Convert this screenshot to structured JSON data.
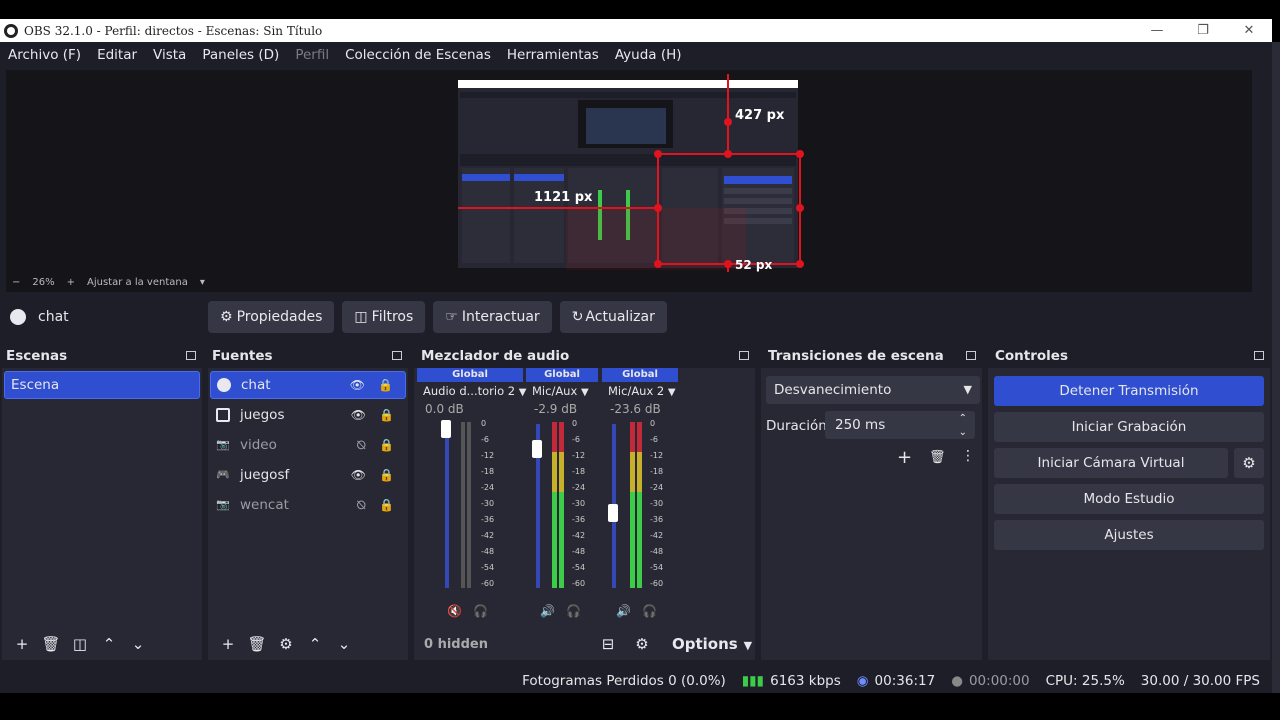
{
  "window": {
    "title": "OBS 32.1.0 - Perfil: directos - Escenas: Sin Título"
  },
  "menu": [
    "Archivo (F)",
    "Editar",
    "Vista",
    "Paneles (D)",
    "Perfil",
    "Colección de Escenas",
    "Herramientas",
    "Ayuda (H)"
  ],
  "preview": {
    "zoom_minus": "−",
    "zoom_value": "26%",
    "zoom_plus": "+",
    "zoom_mode": "Ajustar a la ventana",
    "measure_top": "427 px",
    "measure_left": "1121 px",
    "measure_bottom": "52 px"
  },
  "sourcebar": {
    "selected_source": "chat",
    "properties": "Propiedades",
    "filters": "Filtros",
    "interact": "Interactuar",
    "refresh": "Actualizar"
  },
  "scenes": {
    "title": "Escenas",
    "items": [
      "Escena"
    ]
  },
  "sources": {
    "title": "Fuentes",
    "items": [
      {
        "name": "chat",
        "icon": "globe-icon",
        "visible": true
      },
      {
        "name": "juegos",
        "icon": "monitor-icon",
        "visible": true
      },
      {
        "name": "video",
        "icon": "camera-icon",
        "visible": false
      },
      {
        "name": "juegosf",
        "icon": "gamepad-icon",
        "visible": true
      },
      {
        "name": "wencat",
        "icon": "camera-icon",
        "visible": false
      }
    ]
  },
  "mixer": {
    "title": "Mezclador de audio",
    "hidden": "0 hidden",
    "options": "Options",
    "channels": [
      {
        "head": "Global",
        "name": "Audio d...torio 2",
        "db": "0.0 dB",
        "level": 1.0
      },
      {
        "head": "Global",
        "name": "Mic/Aux",
        "db": "-2.9 dB",
        "level": 0.82
      },
      {
        "head": "Global",
        "name": "Mic/Aux 2",
        "db": "-23.6 dB",
        "level": 0.45
      }
    ],
    "scale": [
      "0",
      "-6",
      "-12",
      "-18",
      "-24",
      "-30",
      "-36",
      "-42",
      "-48",
      "-54",
      "-60"
    ]
  },
  "transitions": {
    "title": "Transiciones de escena",
    "selected": "Desvanecimiento",
    "duration_label": "Duración",
    "duration_value": "250 ms"
  },
  "controls": {
    "title": "Controles",
    "stop_stream": "Detener Transmisión",
    "start_record": "Iniciar Grabación",
    "virtual_cam": "Iniciar Cámara Virtual",
    "studio_mode": "Modo Estudio",
    "settings": "Ajustes"
  },
  "status": {
    "dropped": "Fotogramas Perdidos 0 (0.0%)",
    "bitrate": "6163 kbps",
    "stream_time": "00:36:17",
    "record_time": "00:00:00",
    "cpu": "CPU: 25.5%",
    "fps": "30.00 / 30.00 FPS"
  },
  "colors": {
    "accent": "#2f4fd0",
    "background": "#1d1e27",
    "panel": "#272833",
    "button": "#363744",
    "measure_red": "#e0141e",
    "meter_green": "#3dcc4a",
    "meter_yellow": "#c8b12a",
    "meter_red": "#c22a3a"
  }
}
